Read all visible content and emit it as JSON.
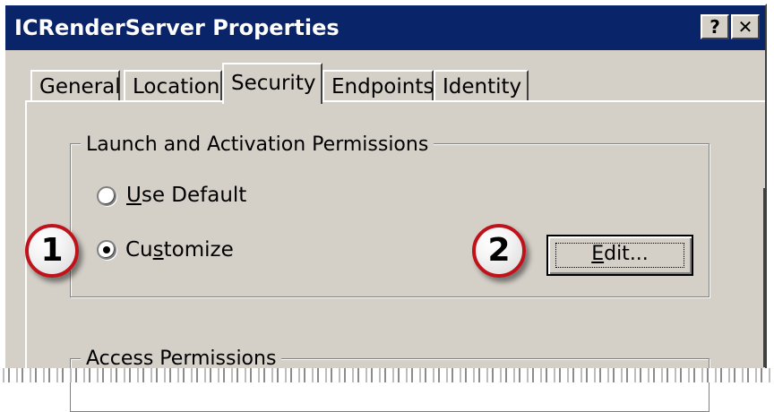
{
  "window": {
    "title": "ICRenderServer Properties",
    "help_label": "?",
    "close_label": "✕"
  },
  "tabs": [
    {
      "label": "General",
      "active": false
    },
    {
      "label": "Location",
      "active": false
    },
    {
      "label": "Security",
      "active": true
    },
    {
      "label": "Endpoints",
      "active": false
    },
    {
      "label": "Identity",
      "active": false
    }
  ],
  "launch_group": {
    "title": "Launch and Activation Permissions",
    "options": [
      {
        "label_prefix": "",
        "label_accel": "U",
        "label_rest": "se Default",
        "selected": false
      },
      {
        "label_prefix": "Cu",
        "label_accel": "s",
        "label_rest": "tomize",
        "selected": true
      }
    ],
    "edit_button": {
      "label_accel": "E",
      "label_rest": "dit..."
    }
  },
  "access_group": {
    "title": "Access Permissions"
  },
  "callouts": [
    "1",
    "2"
  ],
  "colors": {
    "title_bar": "#0a246a",
    "dialog_face": "#d4d0c8",
    "callout_ring": "#c0121b"
  }
}
